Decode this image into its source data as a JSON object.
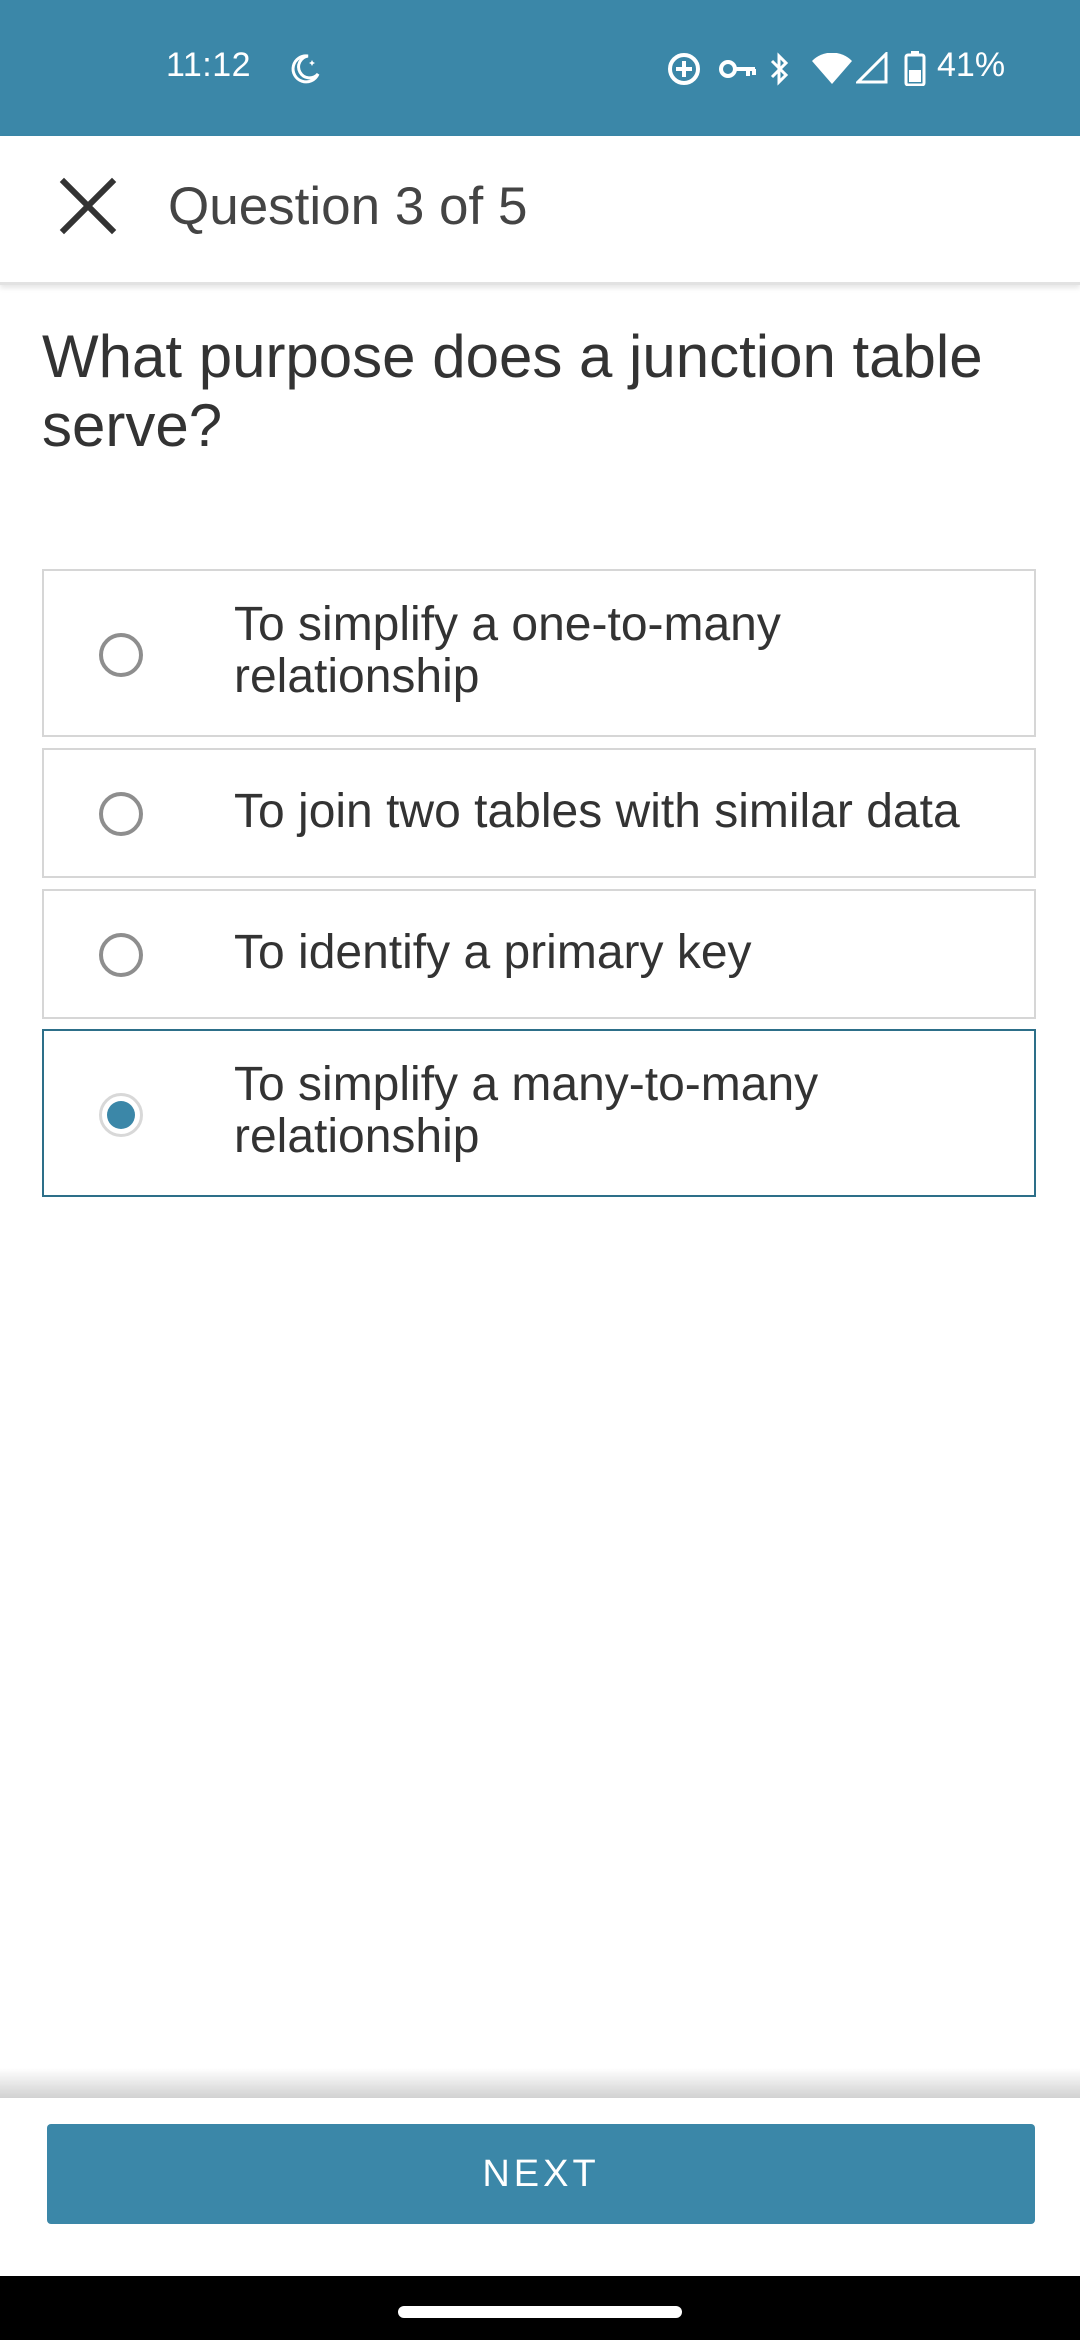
{
  "status_bar": {
    "time": "11:12",
    "battery_percent": "41%",
    "icons": [
      "moon-icon",
      "data-saver-icon",
      "vpn-key-icon",
      "bluetooth-icon",
      "wifi-icon",
      "signal-icon",
      "battery-icon"
    ]
  },
  "app_bar": {
    "close_icon": "close-icon",
    "title": "Question 3 of 5"
  },
  "question": {
    "text": "What purpose does a junction table serve?"
  },
  "options": [
    {
      "label": "To simplify a one-to-many relationship",
      "selected": false
    },
    {
      "label": "To join two tables with similar data",
      "selected": false
    },
    {
      "label": "To identify a primary key",
      "selected": false
    },
    {
      "label": "To simplify a many-to-many relationship",
      "selected": true
    }
  ],
  "footer": {
    "next_label": "NEXT"
  },
  "colors": {
    "accent": "#3b87a8",
    "selected_border": "#2d6f89",
    "text": "#333333"
  }
}
